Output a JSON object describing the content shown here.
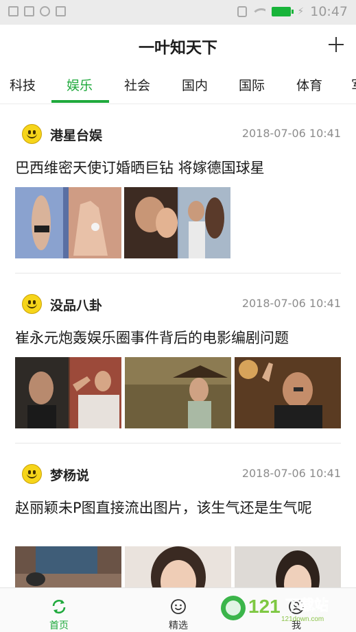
{
  "status_bar": {
    "time": "10:47"
  },
  "header": {
    "title": "一叶知天下",
    "add_icon": "plus-icon"
  },
  "tabs": [
    {
      "label": "科技",
      "active": false
    },
    {
      "label": "娱乐",
      "active": true
    },
    {
      "label": "社会",
      "active": false
    },
    {
      "label": "国内",
      "active": false
    },
    {
      "label": "国际",
      "active": false
    },
    {
      "label": "体育",
      "active": false
    },
    {
      "label": "军",
      "active": false
    }
  ],
  "feed": {
    "items": [
      {
        "source": "港星台娱",
        "source_icon": "smiley-icon",
        "time": "2018-07-06 10:41",
        "title": "巴西维密天使订婚晒巨钻 将嫁德国球星",
        "image_count": 2
      },
      {
        "source": "没品八卦",
        "source_icon": "smiley-icon",
        "time": "2018-07-06 10:41",
        "title": "崔永元炮轰娱乐圈事件背后的电影编剧问题",
        "image_count": 3
      },
      {
        "source": "梦杨说",
        "source_icon": "smiley-icon",
        "time": "2018-07-06 10:41",
        "title": "赵丽颖未P图直接流出图片，该生气还是生气呢",
        "image_count": 3
      }
    ]
  },
  "bottom_nav": [
    {
      "label": "首页",
      "icon": "refresh-icon",
      "active": true
    },
    {
      "label": "精选",
      "icon": "smile-face-icon",
      "active": false
    },
    {
      "label": "我",
      "icon": "profile-icon",
      "active": false
    }
  ],
  "watermark": {
    "text": "121下载站",
    "subtext": "121down.com"
  },
  "colors": {
    "accent": "#1fa93c",
    "battery": "#18b43a",
    "smiley": "#f6d51a"
  }
}
